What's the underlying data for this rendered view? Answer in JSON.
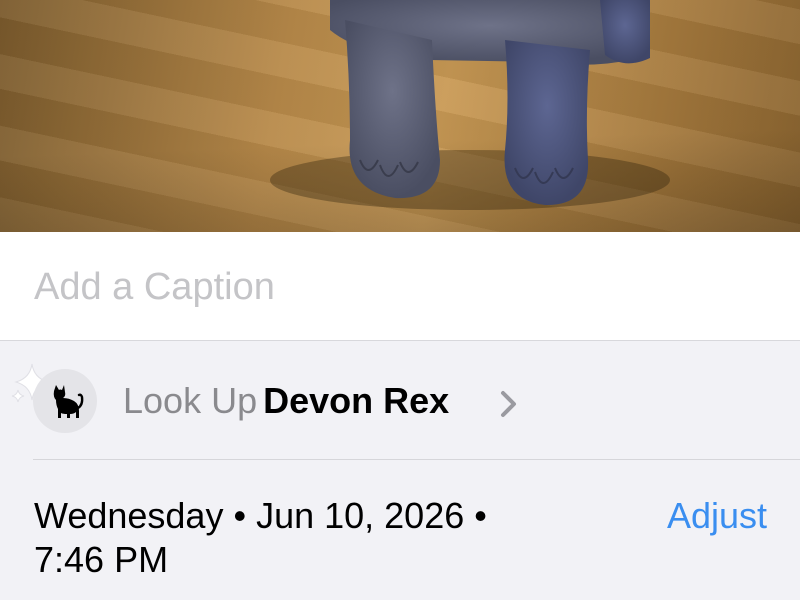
{
  "caption": {
    "placeholder": "Add a Caption",
    "value": ""
  },
  "lookup": {
    "prefix": "Look Up",
    "subject": "Devon Rex",
    "icon": "cat-icon",
    "sparkle_icon": "sparkle-icon",
    "chevron_icon": "chevron-right-icon"
  },
  "datetime": {
    "line1": "Wednesday • Jun 10, 2026 •",
    "line2": "7:46 PM",
    "adjust_label": "Adjust"
  },
  "colors": {
    "accent": "#3a8ef0",
    "secondary_text": "#8a8a8e",
    "placeholder": "#c4c4c7"
  }
}
